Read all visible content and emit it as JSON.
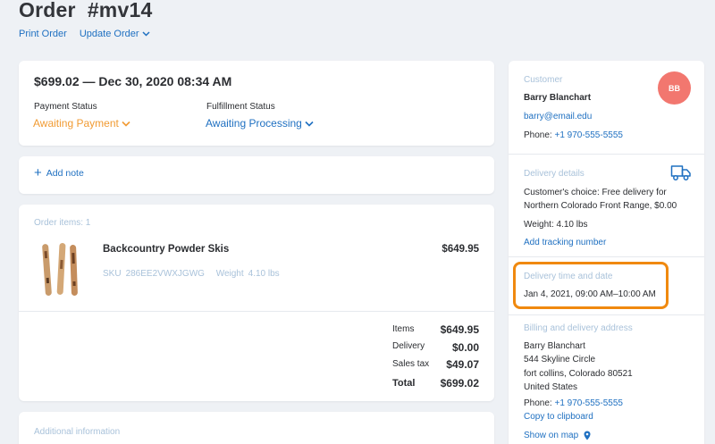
{
  "header": {
    "title": "Order  #mv14",
    "print_label": "Print Order",
    "update_label": "Update Order"
  },
  "summary": {
    "title": "$699.02 — Dec 30, 2020 08:34 AM",
    "payment_status_label": "Payment Status",
    "payment_status_value": "Awaiting Payment",
    "fulfillment_status_label": "Fulfillment Status",
    "fulfillment_status_value": "Awaiting Processing"
  },
  "notes": {
    "add_label": "Add note"
  },
  "items": {
    "heading": "Order items: 1",
    "list": [
      {
        "name": "Backcountry Powder Skis",
        "price": "$649.95",
        "sku_label": "SKU",
        "sku": "286EE2VWXJGWG",
        "weight_label": "Weight",
        "weight": "4.10 lbs"
      }
    ],
    "totals": [
      {
        "label": "Items",
        "value": "$649.95"
      },
      {
        "label": "Delivery",
        "value": "$0.00"
      },
      {
        "label": "Sales tax",
        "value": "$49.07"
      },
      {
        "label": "Total",
        "value": "$699.02"
      }
    ]
  },
  "additional": {
    "heading": "Additional information"
  },
  "customer": {
    "heading": "Customer",
    "name": "Barry Blanchart",
    "initials": "BB",
    "email": "barry@email.edu",
    "phone_label": "Phone:",
    "phone": "+1 970-555-5555"
  },
  "delivery": {
    "heading": "Delivery details",
    "choice_line1": "Customer's choice: Free delivery for",
    "choice_line2": "Northern Colorado Front Range, $0.00",
    "weight": "Weight: 4.10 lbs",
    "tracking_link": "Add tracking number"
  },
  "delivery_time": {
    "heading": "Delivery time and date",
    "value": "Jan 4, 2021, 09:00 AM–10:00 AM"
  },
  "address": {
    "heading": "Billing and delivery address",
    "name": "Barry Blanchart",
    "street": "544 Skyline Circle",
    "city": "fort collins, Colorado 80521",
    "country": "United States",
    "phone_label": "Phone:",
    "phone": "+1 970-555-5555",
    "copy_link": "Copy to clipboard",
    "map_link": "Show on map"
  },
  "colors": {
    "accent": "#1f70c1",
    "warning": "#f19b33",
    "highlight": "#f0890f",
    "avatar": "#f2776f",
    "muted": "#a9c2da"
  }
}
